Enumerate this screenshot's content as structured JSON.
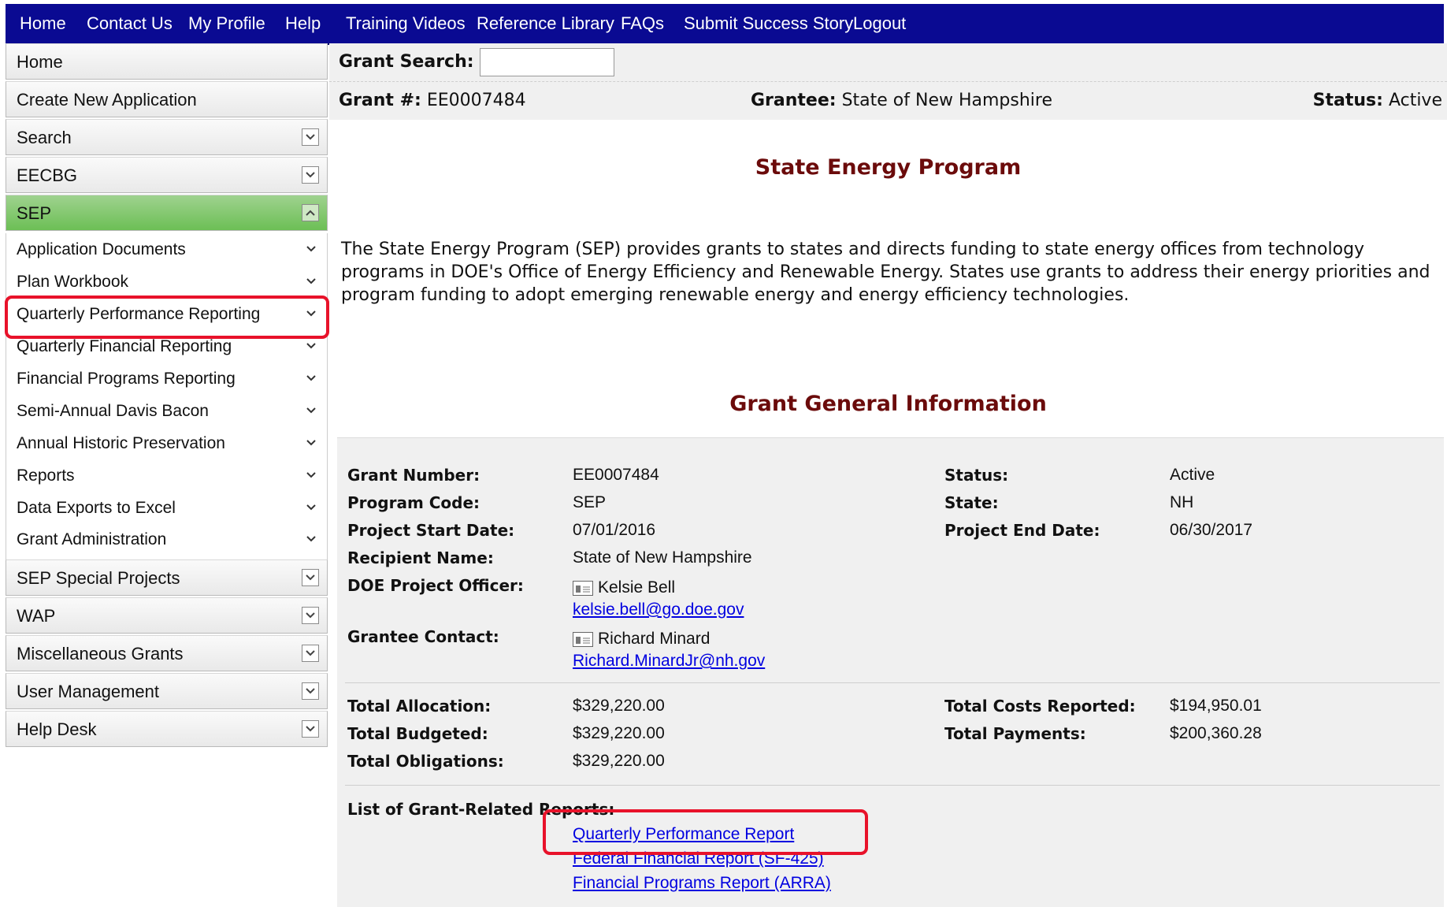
{
  "topnav": {
    "items": [
      "Home",
      "Contact Us",
      "My Profile",
      "Help",
      "Training Videos",
      "Reference Library",
      "FAQs",
      "Submit Success Story",
      "Logout"
    ]
  },
  "sidebar": {
    "top_items": [
      {
        "label": "Home"
      },
      {
        "label": "Create New Application"
      },
      {
        "label": "Search",
        "expand": "collapsed"
      },
      {
        "label": "EECBG",
        "expand": "collapsed"
      },
      {
        "label": "SEP",
        "expand": "expanded"
      }
    ],
    "sep_subitems": [
      "Application Documents",
      "Plan Workbook",
      "Quarterly Performance Reporting",
      "Quarterly Financial Reporting",
      "Financial Programs Reporting",
      "Semi-Annual Davis Bacon",
      "Annual Historic Preservation",
      "Reports",
      "Data Exports to Excel",
      "Grant Administration"
    ],
    "bottom_items": [
      {
        "label": "SEP Special Projects"
      },
      {
        "label": "WAP"
      },
      {
        "label": "Miscellaneous Grants"
      },
      {
        "label": "User Management"
      },
      {
        "label": "Help Desk"
      }
    ]
  },
  "header": {
    "grant_search_label": "Grant Search:",
    "grant_search_value": "",
    "grant_no_label": "Grant #:",
    "grant_no_value": "EE0007484",
    "grantee_label": "Grantee:",
    "grantee_value": "State of New Hampshire",
    "status_label": "Status:",
    "status_value": "Active"
  },
  "main": {
    "program_title": "State Energy Program",
    "description": "The State Energy Program (SEP) provides grants to states and directs funding to state energy offices from technology programs in DOE's Office of Energy Efficiency and Renewable Energy. States use grants to address their energy priorities and program funding to adopt emerging renewable energy and energy efficiency technologies.",
    "section_title": "Grant General Information"
  },
  "info": {
    "grant_number_label": "Grant Number:",
    "grant_number": "EE0007484",
    "program_code_label": "Program Code:",
    "program_code": "SEP",
    "start_label": "Project Start Date:",
    "start": "07/01/2016",
    "recipient_label": "Recipient Name:",
    "recipient": "State of New Hampshire",
    "officer_label": "DOE Project Officer:",
    "officer_name": "Kelsie Bell",
    "officer_email": "kelsie.bell@go.doe.gov",
    "contact_label": "Grantee Contact:",
    "contact_name": "Richard Minard",
    "contact_email": "Richard.MinardJr@nh.gov",
    "status_label": "Status:",
    "status": "Active",
    "state_label": "State:",
    "state": "NH",
    "end_label": "Project End Date:",
    "end": "06/30/2017",
    "total_allocation_label": "Total Allocation:",
    "total_allocation": "$329,220.00",
    "total_budgeted_label": "Total Budgeted:",
    "total_budgeted": "$329,220.00",
    "total_obligations_label": "Total Obligations:",
    "total_obligations": "$329,220.00",
    "total_costs_label": "Total Costs Reported:",
    "total_costs": "$194,950.01",
    "total_payments_label": "Total Payments:",
    "total_payments": "$200,360.28",
    "reports_label": "List of Grant-Related Reports:",
    "reports": [
      "Quarterly Performance Report",
      "Federal Financial Report (SF-425)",
      "Financial Programs Report (ARRA)"
    ]
  },
  "colors": {
    "nav_bg": "#0a0a92",
    "active_green": "#6cbf55",
    "title_maroon": "#6b0b0b",
    "link_blue": "#0000e0",
    "highlight_red": "#e8122a"
  }
}
